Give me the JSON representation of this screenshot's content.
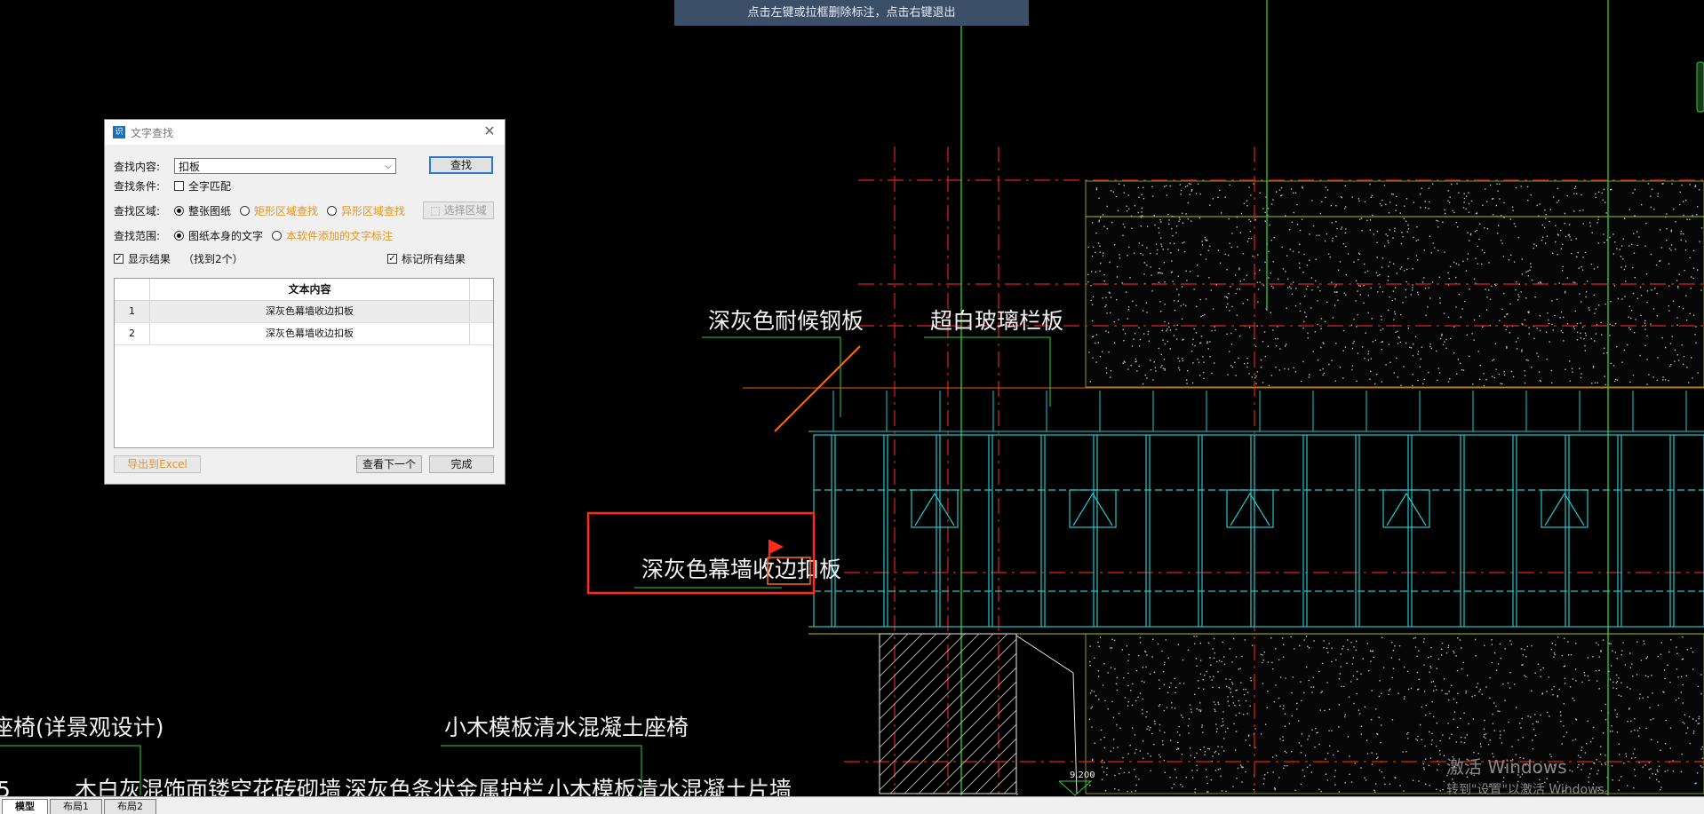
{
  "hint_bar": {
    "text": "点击左键或拉框删除标注，点击右键退出"
  },
  "dialog": {
    "title": "文字查找",
    "find_label": "查找内容:",
    "find_value": "扣板",
    "find_button": "查找",
    "condition_label": "查找条件:",
    "whole_word": "全字匹配",
    "area_label": "查找区域:",
    "area_options": [
      "整张图纸",
      "矩形区域查找",
      "异形区域查找"
    ],
    "select_area_button": "选择区域",
    "scope_label": "查找范围:",
    "scope_options": [
      "图纸本身的文字",
      "本软件添加的文字标注"
    ],
    "show_results": "显示结果",
    "found_count": "（找到2个）",
    "mark_all": "标记所有结果",
    "table_header": "文本内容",
    "rows": [
      {
        "index": "1",
        "text": "深灰色幕墙收边扣板"
      },
      {
        "index": "2",
        "text": "深灰色幕墙收边扣板"
      }
    ],
    "export_button": "导出到Excel",
    "next_button": "查看下一个",
    "done_button": "完成"
  },
  "drawing_labels": {
    "l1": "深灰色耐候钢板",
    "l2": "超白玻璃栏板",
    "l3": "深灰色幕墙收边扣板",
    "l4": "座椅(详景观设计)",
    "l5": "小木模板清水混凝土座椅",
    "l6": "木白灰混饰面镂空花砖砌墙",
    "l7": "深灰色条状金属护栏",
    "l8": "小木模板清水混凝土片墙",
    "l9": "5",
    "elev": "9.200"
  },
  "tabs": [
    "模型",
    "布局1",
    "布局2"
  ],
  "watermark": {
    "line1": "激活 Windows",
    "line2": "转到\"设置\"以激活 Windows。"
  },
  "colors": {
    "hint_bg": "#3c4f69",
    "cad_green": "#33cc33",
    "cad_red": "#e0201e",
    "cad_cyan": "#1fc8cc",
    "highlight": "#ff2a1a"
  }
}
